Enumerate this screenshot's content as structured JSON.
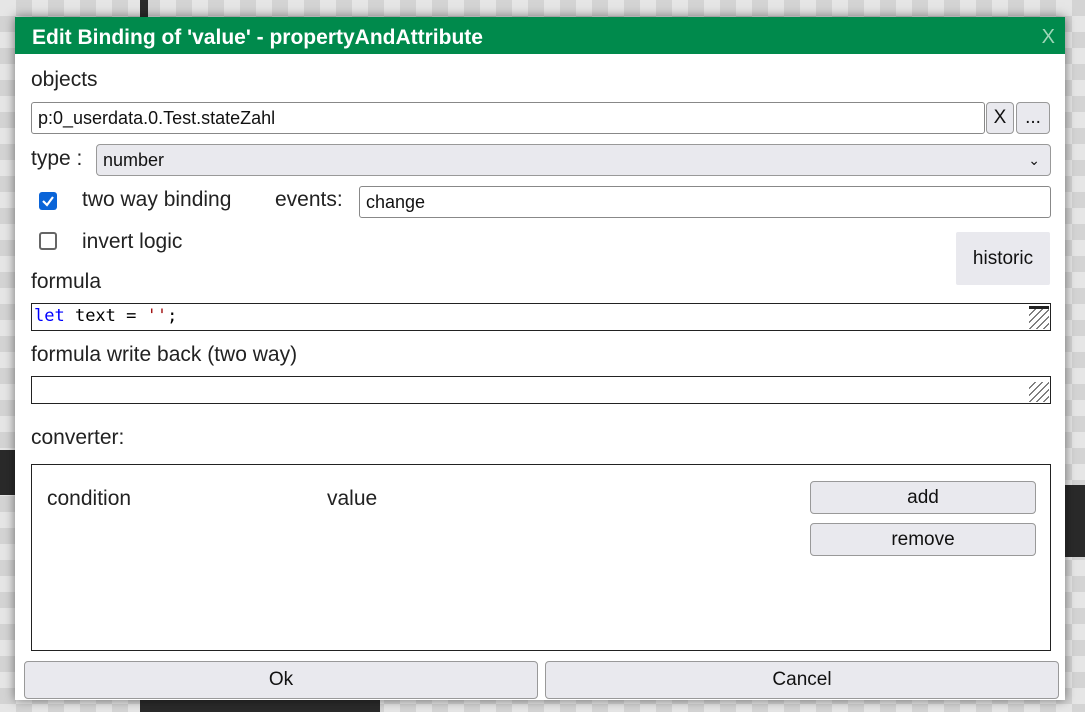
{
  "dialog": {
    "title": "Edit Binding of 'value' - propertyAndAttribute",
    "close_label": "X",
    "objects_label": "objects",
    "objects_value": "p:0_userdata.0.Test.stateZahl",
    "clear_label": "X",
    "browse_label": "...",
    "type_label": "type :",
    "type_value": "number",
    "two_way_label": "two way binding",
    "two_way_checked": true,
    "events_label": "events:",
    "events_value": "change",
    "invert_label": "invert logic",
    "invert_checked": false,
    "historic_label": "historic",
    "formula_label": "formula",
    "formula_code": {
      "kw": "let",
      "rest": " text = ",
      "str": "''",
      "end": ";"
    },
    "formula_write_back_label": "formula write back (two way)",
    "formula_write_back_value": "",
    "converter_label": "converter:",
    "converter": {
      "col_condition": "condition",
      "col_value": "value",
      "add_label": "add",
      "remove_label": "remove"
    },
    "ok_label": "Ok",
    "cancel_label": "Cancel"
  },
  "colors": {
    "titlebar": "#008a4c",
    "checkbox": "#0a64d8",
    "keyword": "#0000ff",
    "string": "#a31515"
  }
}
